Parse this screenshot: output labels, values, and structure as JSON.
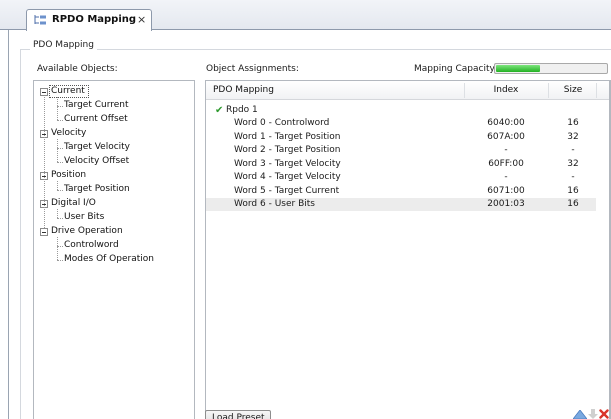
{
  "tab": {
    "title": "RPDO Mapping",
    "close": "×",
    "icon": "mapping-tree-icon"
  },
  "group_title": "PDO Mapping",
  "available_label": "Available Objects:",
  "assignments_label": "Object Assignments:",
  "capacity": {
    "label": "Mapping Capacity:",
    "fraction": 0.4,
    "color": "#2cbb2c"
  },
  "tree": {
    "groups": [
      {
        "label": "Current",
        "children": [
          "Target Current",
          "Current Offset"
        ]
      },
      {
        "label": "Velocity",
        "children": [
          "Target Velocity",
          "Velocity Offset"
        ]
      },
      {
        "label": "Position",
        "children": [
          "Target Position"
        ]
      },
      {
        "label": "Digital I/O",
        "children": [
          "User Bits"
        ]
      },
      {
        "label": "Drive Operation",
        "children": [
          "Controlword",
          "Modes Of Operation"
        ]
      }
    ]
  },
  "table": {
    "columns": {
      "name": "PDO Mapping",
      "index": "Index",
      "size": "Size"
    },
    "group_label": "Rpdo 1",
    "rows": [
      {
        "name": "Word 0 - Controlword",
        "index": "6040:00",
        "size": "16"
      },
      {
        "name": "Word 1 - Target Position",
        "index": "607A:00",
        "size": "32"
      },
      {
        "name": "Word 2 - Target Position",
        "index": "-",
        "size": "-"
      },
      {
        "name": "Word 3 - Target Velocity",
        "index": "60FF:00",
        "size": "32"
      },
      {
        "name": "Word 4 - Target Velocity",
        "index": "-",
        "size": "-"
      },
      {
        "name": "Word 5 - Target Current",
        "index": "6071:00",
        "size": "16"
      },
      {
        "name": "Word 6 - User Bits",
        "index": "2001:03",
        "size": "16",
        "selected": true
      }
    ]
  },
  "load_button": "Load Preset",
  "icons": {
    "move_up": "arrow-up-icon",
    "move_down": "arrow-down-icon",
    "delete": "delete-icon"
  }
}
